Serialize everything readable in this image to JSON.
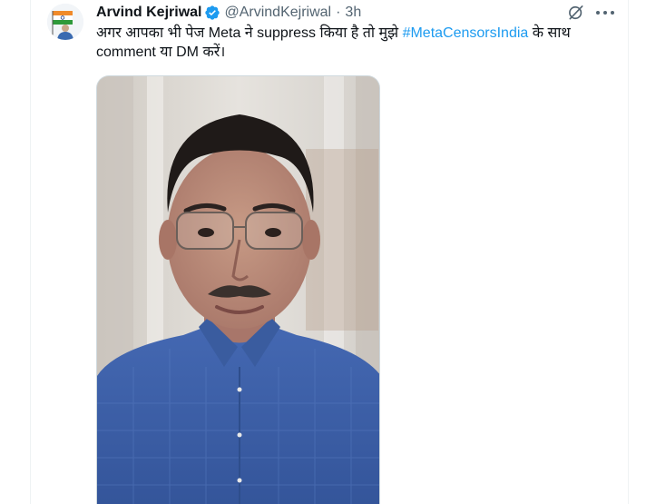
{
  "tweet": {
    "author": {
      "display_name": "Arvind Kejriwal",
      "handle": "@ArvindKejriwal",
      "verified": true,
      "avatar_icon": "avatar-image",
      "verified_icon": "verified-badge-icon"
    },
    "separator": "·",
    "time": "3h",
    "text_before": "अगर आपका भी पेज Meta ने suppress किया है तो मुझे ",
    "hashtag": "#MetaCensorsIndia",
    "text_after": " के साथ comment या DM करें।",
    "actions": {
      "grok_icon": "grok-icon",
      "more_icon": "more-options-icon"
    },
    "media": {
      "type": "video-thumbnail",
      "icon": "video-thumbnail-image"
    }
  },
  "colors": {
    "accent": "#1d9bf0",
    "text_primary": "#0f1419",
    "text_secondary": "#536471",
    "border": "#cfd9de",
    "shirt": "#3c5fa7"
  }
}
